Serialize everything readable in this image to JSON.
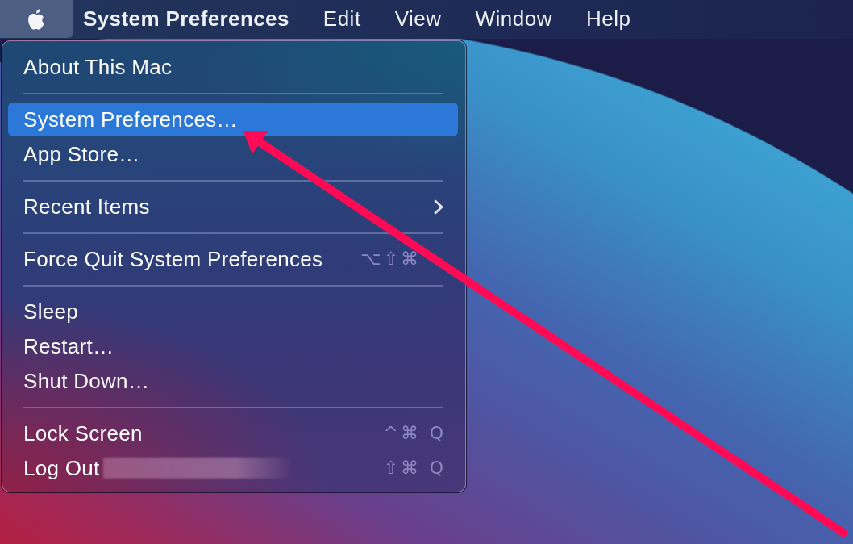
{
  "menu_bar": {
    "items": [
      {
        "kind": "apple",
        "selected": true
      },
      {
        "kind": "app",
        "label": "System Preferences",
        "selected": false
      },
      {
        "kind": "menu",
        "label": "Edit",
        "selected": false
      },
      {
        "kind": "menu",
        "label": "View",
        "selected": false
      },
      {
        "kind": "menu",
        "label": "Window",
        "selected": false
      },
      {
        "kind": "menu",
        "label": "Help",
        "selected": false
      }
    ]
  },
  "apple_menu": {
    "sections": [
      {
        "items": [
          {
            "label": "About This Mac",
            "selected": false
          }
        ]
      },
      {
        "items": [
          {
            "label": "System Preferences…",
            "selected": true
          },
          {
            "label": "App Store…",
            "selected": false
          }
        ]
      },
      {
        "items": [
          {
            "label": "Recent Items",
            "selected": false,
            "submenu": true
          }
        ]
      },
      {
        "items": [
          {
            "label": "Force Quit System Preferences",
            "selected": false,
            "shortcut": {
              "modifiers": "⌥⇧⌘"
            }
          }
        ]
      },
      {
        "items": [
          {
            "label": "Sleep",
            "selected": false
          },
          {
            "label": "Restart…",
            "selected": false
          },
          {
            "label": "Shut Down…",
            "selected": false
          }
        ]
      },
      {
        "items": [
          {
            "label": "Lock Screen",
            "selected": false,
            "shortcut": {
              "modifiers": "^⌘",
              "key": "Q"
            }
          },
          {
            "label": "Log Out",
            "selected": false,
            "redacted": true,
            "shortcut": {
              "modifiers": "⇧⌘",
              "key": "Q"
            }
          }
        ]
      }
    ]
  }
}
